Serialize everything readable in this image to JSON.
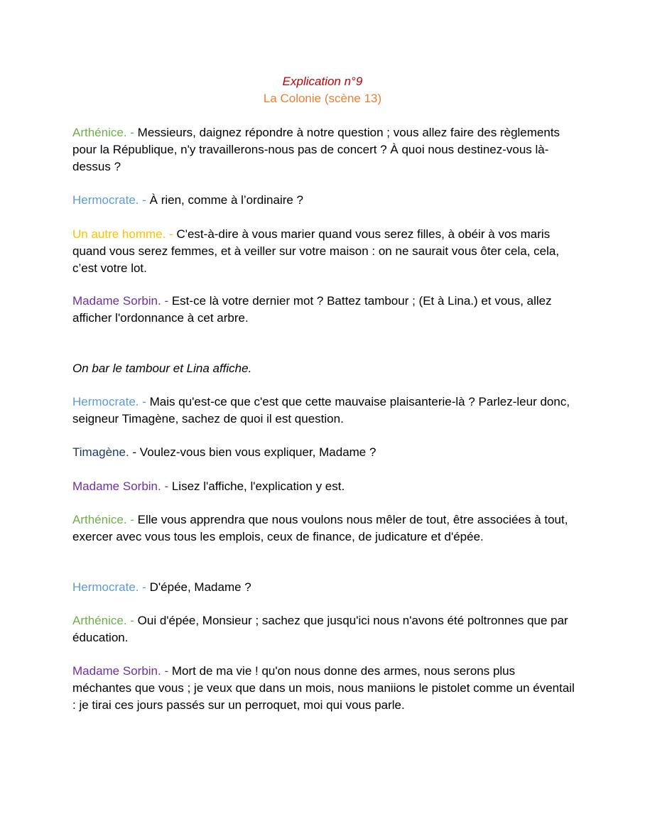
{
  "colors": {
    "title": "#c00000",
    "subtitle": "#ed7d31",
    "arthenice": "#70ad47",
    "hermocrate": "#5b9bd5",
    "autre_homme": "#ffc000",
    "madame_sorbin": "#7030a0",
    "timagene": "#1f3864",
    "text": "#000000"
  },
  "header": {
    "title": "Explication n°9",
    "subtitle": "La Colonie (scène 13)"
  },
  "lines": [
    {
      "speaker": "Arthénice. - ",
      "color_key": "arthenice",
      "text": "Messieurs, daignez répondre à notre question ; vous allez faire des règlements pour la République, n'y travaillerons-nous pas de concert ? À quoi nous destinez-vous là-dessus ?"
    },
    {
      "speaker": "Hermocrate. - ",
      "color_key": "hermocrate",
      "text": "À rien, comme à l’ordinaire ?"
    },
    {
      "speaker": "Un autre homme. - ",
      "color_key": "autre_homme",
      "text": "C'est-à-dire à vous marier quand vous serez filles, à obéir à vos maris quand vous serez femmes, et à veiller sur votre maison : on ne saurait vous ôter cela, cela, c’est votre lot."
    },
    {
      "speaker": "Madame Sorbin. - ",
      "color_key": "madame_sorbin",
      "text": "Est-ce là votre dernier mot ? Battez tambour ; (Et à Lina.) et vous, allez afficher l'ordonnance à cet arbre."
    },
    {
      "stage_direction": "On bar le tambour et Lina affiche."
    },
    {
      "speaker": "Hermocrate. - ",
      "color_key": "hermocrate",
      "text": "Mais qu'est-ce que c'est que cette mauvaise plaisanterie-là ? Parlez-leur donc, seigneur Timagène, sachez de quoi il est question."
    },
    {
      "speaker": "Timagène.",
      "color_key": "timagene",
      "text": " - Voulez-vous bien vous expliquer, Madame ?"
    },
    {
      "speaker": "Madame Sorbin. - ",
      "color_key": "madame_sorbin",
      "text": "Lisez l'affiche, l'explication y est."
    },
    {
      "speaker": "Arthénice. - ",
      "color_key": "arthenice",
      "text": "Elle vous apprendra que nous voulons nous mêler de tout, être associées à tout, exercer avec vous tous les emplois, ceux de finance, de judicature et d'épée."
    },
    {
      "speaker": "Hermocrate. - ",
      "color_key": "hermocrate",
      "text": "D'épée, Madame ?"
    },
    {
      "speaker": "Arthénice. - ",
      "color_key": "arthenice",
      "text": "Oui d'épée, Monsieur ; sachez que jusqu'ici nous n'avons été poltronnes que par éducation."
    },
    {
      "speaker": "Madame Sorbin. - ",
      "color_key": "madame_sorbin",
      "text": "Mort de ma vie ! qu'on nous donne des armes, nous serons plus méchantes que vous ; je veux que dans un mois, nous maniions le pistolet comme un éventail : je tirai ces jours passés sur un perroquet, moi qui vous parle."
    }
  ]
}
